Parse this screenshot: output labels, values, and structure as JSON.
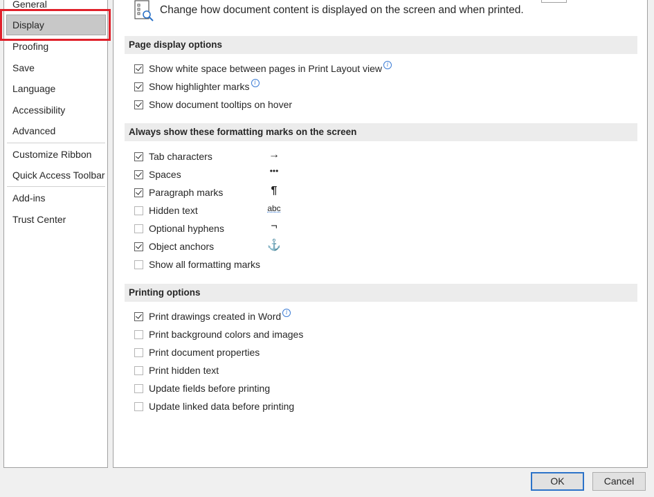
{
  "sidebar": {
    "items": [
      {
        "label": "General"
      },
      {
        "label": "Display"
      },
      {
        "label": "Proofing"
      },
      {
        "label": "Save"
      },
      {
        "label": "Language"
      },
      {
        "label": "Accessibility"
      },
      {
        "label": "Advanced"
      },
      {
        "label": "Customize Ribbon"
      },
      {
        "label": "Quick Access Toolbar"
      },
      {
        "label": "Add-ins"
      },
      {
        "label": "Trust Center"
      }
    ],
    "selected": "Display"
  },
  "header": {
    "description": "Change how document content is displayed on the screen and when printed."
  },
  "sections": {
    "page_display": {
      "title": "Page display options",
      "options": [
        {
          "label": "Show white space between pages in Print Layout view",
          "checked": true
        },
        {
          "label": "Show highlighter marks",
          "checked": true
        },
        {
          "label": "Show document tooltips on hover",
          "checked": true
        }
      ]
    },
    "formatting_marks": {
      "title": "Always show these formatting marks on the screen",
      "options": [
        {
          "label": "Tab characters",
          "checked": true,
          "mark": "→"
        },
        {
          "label": "Spaces",
          "checked": true,
          "mark": "•••"
        },
        {
          "label": "Paragraph marks",
          "checked": true,
          "mark": "¶"
        },
        {
          "label": "Hidden text",
          "checked": false,
          "mark": "abc"
        },
        {
          "label": "Optional hyphens",
          "checked": false,
          "mark": "¬"
        },
        {
          "label": "Object anchors",
          "checked": true,
          "mark": "⚓"
        },
        {
          "label": "Show all formatting marks",
          "checked": false
        }
      ]
    },
    "printing": {
      "title": "Printing options",
      "options": [
        {
          "label": "Print drawings created in Word",
          "checked": true
        },
        {
          "label": "Print background colors and images",
          "checked": false
        },
        {
          "label": "Print document properties",
          "checked": false
        },
        {
          "label": "Print hidden text",
          "checked": false
        },
        {
          "label": "Update fields before printing",
          "checked": false
        },
        {
          "label": "Update linked data before printing",
          "checked": false
        }
      ]
    }
  },
  "buttons": {
    "ok": "OK",
    "cancel": "Cancel"
  },
  "colors": {
    "highlight": "#e0202a",
    "info_icon": "#3a7bd5",
    "primary_button_border": "#2b72c8"
  }
}
